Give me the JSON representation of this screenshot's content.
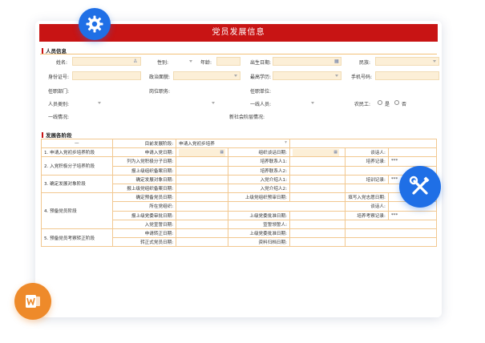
{
  "form": {
    "title": "党员发展信息",
    "section1": "人员信息",
    "section2": "发展各阶段",
    "fields": {
      "name": "姓名:",
      "gender": "性别:",
      "age": "年龄:",
      "birth": "出生日期:",
      "ethnic": "民族:",
      "idcard": "身份证号:",
      "political": "政治面貌:",
      "education": "最高学历:",
      "phone": "手机号码:",
      "dept": "任职部门:",
      "position": "岗位职务:",
      "unit": "任职单位:",
      "category": "人员类别:",
      "frontline": "一线人员:",
      "farmer": "农民工:",
      "yes": "是",
      "no": "否",
      "frontline_status": "一线情况:",
      "new_social": "新社会阶层情况:"
    },
    "stage_header": {
      "dash": "—",
      "current_label": "目前发展阶段:",
      "current_value": "申请入党初步培养"
    },
    "stages": [
      {
        "name": "1. 申请入党初步培养阶段",
        "rows": [
          {
            "c1": "申请入党日期:",
            "c3": "组织谈话日期:",
            "c5": "谈话人:"
          }
        ]
      },
      {
        "name": "2. 入党积极分子培养阶段",
        "rows": [
          {
            "c1": "列为入党积极分子日期:",
            "c3": "培养联系人1:",
            "c5": "培养记录:",
            "c6": "***"
          },
          {
            "c1": "报上级组织备案日期:",
            "c3": "培养联系人2:"
          }
        ]
      },
      {
        "name": "3. 确定发展对象阶段",
        "rows": [
          {
            "c1": "确定发展对象日期:",
            "c3": "入党介绍人1:",
            "c5": "培训记录:",
            "c6": "***"
          },
          {
            "c1": "报上级党组织备案日期:",
            "c3": "入党介绍人2:"
          }
        ]
      },
      {
        "name": "4. 预备党员阶段",
        "rows": [
          {
            "c1": "确定预备党员日期:",
            "c3": "上级党组织预审日期:",
            "c5": "填写入党志愿日期:"
          },
          {
            "c1": "所在党组织:",
            "c5": "谈话人:"
          },
          {
            "c1": "报上级党委审批日期:",
            "c3": "上级党委批准日期:",
            "c5": "培养考察记录:",
            "c6": "***"
          },
          {
            "c1": "入党宣誓日期:",
            "c3": "宣誓领誓人:"
          }
        ]
      },
      {
        "name": "5. 预备党员考察转正阶段",
        "rows": [
          {
            "c1": "申请转正日期:",
            "c3": "上级党委批准日期:"
          },
          {
            "c1": "转正式党员日期:",
            "c3": "资料归档日期:"
          }
        ]
      }
    ]
  },
  "icons": {
    "gear": "gear-icon",
    "tools": "tools-icon",
    "word": "word-document-icon",
    "calendar": "calendar-icon",
    "person": "person-icon"
  },
  "colors": {
    "accent_red": "#c81414",
    "badge_blue": "#1f6fe6",
    "badge_orange": "#ee8a2a",
    "input_fill": "#fcefd7",
    "grid_line": "#f2c890"
  }
}
